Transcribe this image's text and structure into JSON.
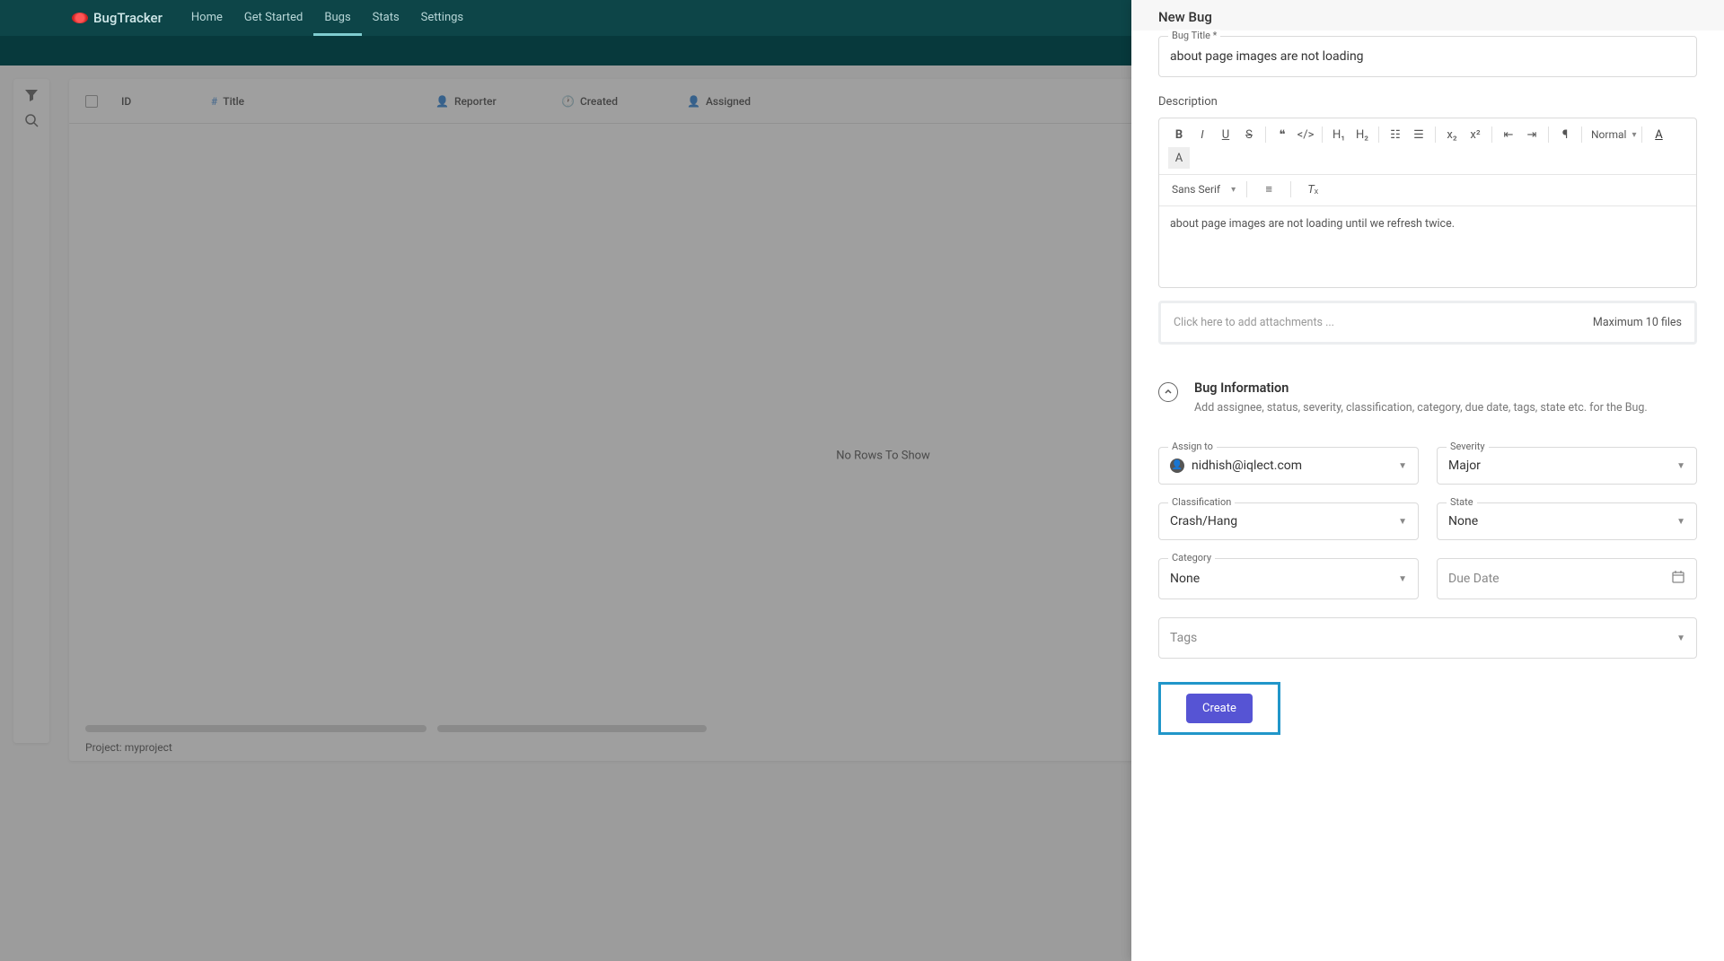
{
  "app": {
    "name": "BugTracker"
  },
  "nav": {
    "items": [
      {
        "label": "Home"
      },
      {
        "label": "Get Started"
      },
      {
        "label": "Bugs"
      },
      {
        "label": "Stats"
      },
      {
        "label": "Settings"
      }
    ]
  },
  "table": {
    "columns": {
      "id": "ID",
      "title": "Title",
      "reporter": "Reporter",
      "created": "Created",
      "assigned": "Assigned"
    },
    "no_rows": "No Rows To Show",
    "project_label": "Project: myproject"
  },
  "drawer": {
    "title": "New Bug",
    "bug_title_label": "Bug Title *",
    "bug_title_value": "about page images are not loading",
    "description_label": "Description",
    "description_value": "about page images are not loading until we refresh twice.",
    "font_family": "Sans Serif",
    "paragraph_style": "Normal",
    "attachment_placeholder": "Click here to add attachments ...",
    "attachment_limit": "Maximum 10 files",
    "section_title": "Bug Information",
    "section_sub": "Add assignee, status, severity, classification, category, due date, tags, state etc. for the Bug.",
    "fields": {
      "assign_to": {
        "label": "Assign to",
        "value": "nidhish@iqlect.com"
      },
      "severity": {
        "label": "Severity",
        "value": "Major"
      },
      "classification": {
        "label": "Classification",
        "value": "Crash/Hang"
      },
      "state": {
        "label": "State",
        "value": "None"
      },
      "category": {
        "label": "Category",
        "value": "None"
      },
      "due_date": {
        "placeholder": "Due Date"
      },
      "tags": {
        "placeholder": "Tags"
      }
    },
    "create_button": "Create"
  }
}
